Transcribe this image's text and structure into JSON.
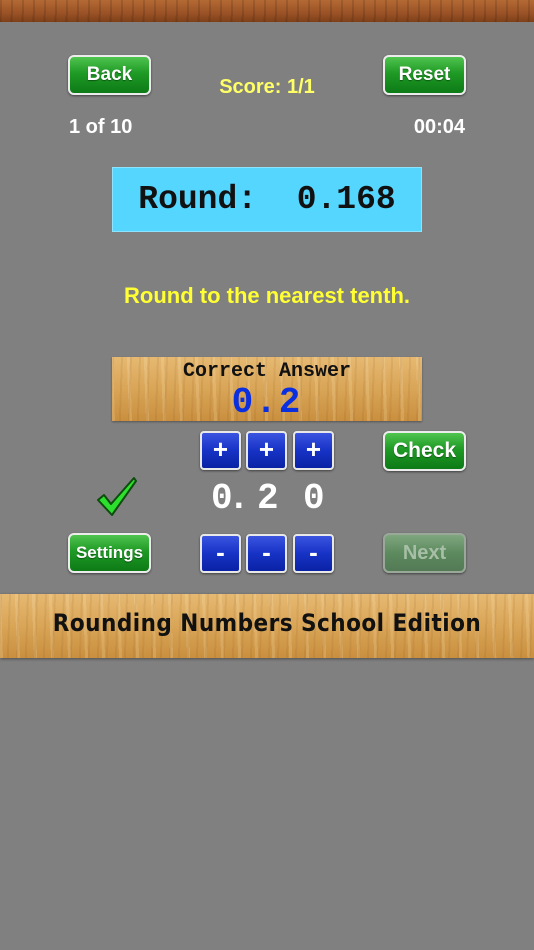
{
  "header": {
    "back_label": "Back",
    "reset_label": "Reset",
    "score": "Score: 1/1",
    "progress": "1 of 10",
    "timer": "00:04"
  },
  "question": {
    "prompt": "Round:  0.168",
    "instruction": "Round to the nearest tenth."
  },
  "answer": {
    "title": "Correct Answer",
    "value": "0.2"
  },
  "input": {
    "digits": [
      "0",
      ".",
      "2",
      "0"
    ],
    "plus_label": "+",
    "minus_label": "-",
    "check_label": "Check",
    "result_icon": "checkmark-icon"
  },
  "footer": {
    "settings_label": "Settings",
    "next_label": "Next",
    "banner": "Rounding Numbers School Edition"
  },
  "colors": {
    "background": "#808080",
    "accent_yellow": "#ffff33",
    "question_box": "#55d6ff",
    "answer_blue": "#0a2fe0",
    "green_button": "#1f9a25",
    "blue_button": "#1733c6"
  }
}
